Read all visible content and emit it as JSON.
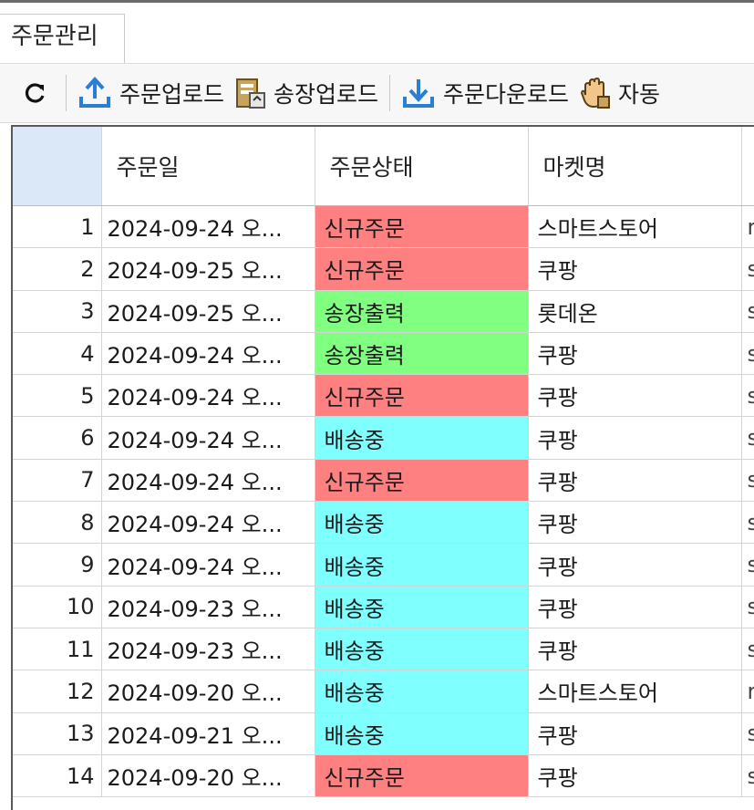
{
  "tab": {
    "label": "주문관리"
  },
  "toolbar": {
    "refresh_icon": "refresh-icon",
    "upload_order_label": "주문업로드",
    "upload_invoice_label": "송장업로드",
    "download_order_label": "주문다운로드",
    "auto_label": "자동"
  },
  "colors": {
    "new_order": "#ff8080",
    "invoice_printed": "#80ff80",
    "shipping": "#80ffff",
    "header_corner": "#dbe8f7",
    "accent_blue": "#2a7fd4"
  },
  "grid": {
    "columns": [
      "주문일",
      "주문상태",
      "마켓명"
    ],
    "rows": [
      {
        "no": "1",
        "date": "2024-09-24 오...",
        "status": "신규주문",
        "market": "스마트스토어",
        "extra": "r"
      },
      {
        "no": "2",
        "date": "2024-09-25 오...",
        "status": "신규주문",
        "market": "쿠팡",
        "extra": "s"
      },
      {
        "no": "3",
        "date": "2024-09-25 오...",
        "status": "송장출력",
        "market": "롯데온",
        "extra": "s"
      },
      {
        "no": "4",
        "date": "2024-09-24 오...",
        "status": "송장출력",
        "market": "쿠팡",
        "extra": "s"
      },
      {
        "no": "5",
        "date": "2024-09-24 오...",
        "status": "신규주문",
        "market": "쿠팡",
        "extra": "s"
      },
      {
        "no": "6",
        "date": "2024-09-24 오...",
        "status": "배송중",
        "market": "쿠팡",
        "extra": "s"
      },
      {
        "no": "7",
        "date": "2024-09-24 오...",
        "status": "신규주문",
        "market": "쿠팡",
        "extra": "s"
      },
      {
        "no": "8",
        "date": "2024-09-24 오...",
        "status": "배송중",
        "market": "쿠팡",
        "extra": "s"
      },
      {
        "no": "9",
        "date": "2024-09-24 오...",
        "status": "배송중",
        "market": "쿠팡",
        "extra": "s"
      },
      {
        "no": "10",
        "date": "2024-09-23 오...",
        "status": "배송중",
        "market": "쿠팡",
        "extra": "s"
      },
      {
        "no": "11",
        "date": "2024-09-23 오...",
        "status": "배송중",
        "market": "쿠팡",
        "extra": "s"
      },
      {
        "no": "12",
        "date": "2024-09-20 오...",
        "status": "배송중",
        "market": "스마트스토어",
        "extra": "r"
      },
      {
        "no": "13",
        "date": "2024-09-21 오...",
        "status": "배송중",
        "market": "쿠팡",
        "extra": "s"
      },
      {
        "no": "14",
        "date": "2024-09-20 오...",
        "status": "신규주문",
        "market": "쿠팡",
        "extra": "s"
      }
    ]
  }
}
